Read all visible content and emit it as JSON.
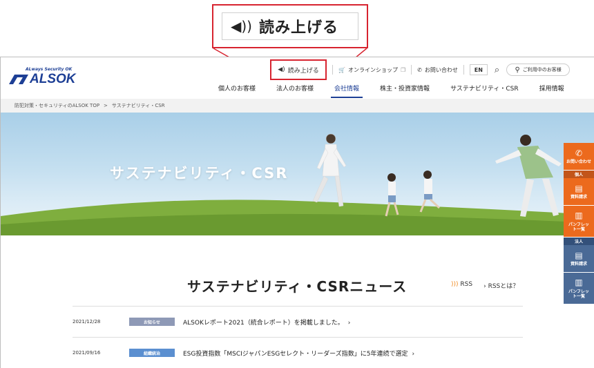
{
  "callout": {
    "speaker": "◀))",
    "label": "読み上げる"
  },
  "logo": {
    "tagline": "ALways Security OK",
    "wordmark": "ALSOK"
  },
  "utility": {
    "read_aloud": "読み上げる",
    "online_shop": "オンラインショップ",
    "contact": "お問い合わせ",
    "language": "EN",
    "member": "ご利用中のお客様"
  },
  "gnav": [
    {
      "label": "個人のお客様",
      "active": false
    },
    {
      "label": "法人のお客様",
      "active": false
    },
    {
      "label": "会社情報",
      "active": true
    },
    {
      "label": "株主・投資家情報",
      "active": false
    },
    {
      "label": "サステナビリティ・CSR",
      "active": false
    },
    {
      "label": "採用情報",
      "active": false
    }
  ],
  "breadcrumb": {
    "items": [
      "防犯対策・セキュリティのALSOK TOP",
      "サステナビリティ・CSR"
    ],
    "separator": ">"
  },
  "hero": {
    "title": "サステナビリティ・CSR"
  },
  "news": {
    "title": "サステナビリティ・CSRニュース",
    "rss": "RSS",
    "rss_about": "RSSとは？",
    "items": [
      {
        "date": "2021/12/28",
        "category": "お知らせ",
        "category_color": "#8e99b6",
        "text": "ALSOKレポート2021（統合レポート）を掲載しました。"
      },
      {
        "date": "2021/09/16",
        "category": "組織統治",
        "category_color": "#5b8fd0",
        "text": "ESG投資指数「MSCIジャパンESGセレクト・リーダーズ指数」に5年連続で選定"
      }
    ]
  },
  "side": {
    "contact": "お問い合わせ",
    "personal_head": "個人",
    "personal_docs": "資料請求",
    "personal_pamphlet": "パンフレット一覧",
    "corp_head": "法人",
    "corp_docs": "資料請求",
    "corp_pamphlet": "パンフレット一覧"
  },
  "colors": {
    "brand": "#1d3f95",
    "highlight": "#d7232f",
    "accent_orange": "#ec6a1d",
    "side_blue": "#4a6a96"
  }
}
